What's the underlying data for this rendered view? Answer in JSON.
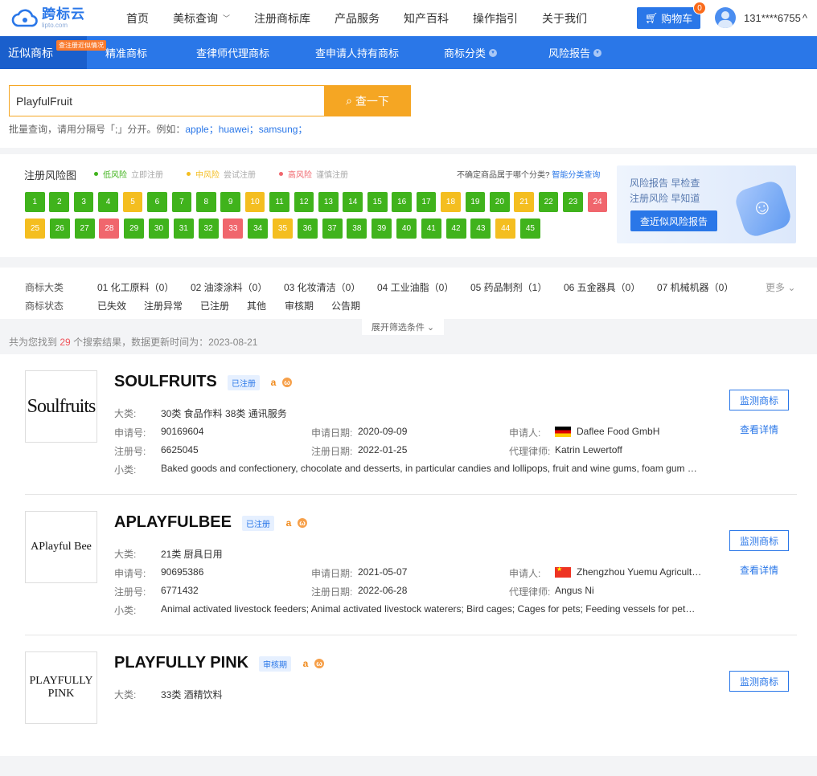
{
  "header": {
    "logo_text": "跨标云",
    "logo_sub": "lipto.com",
    "nav": [
      "首页",
      "美标查询",
      "注册商标库",
      "产品服务",
      "知产百科",
      "操作指引",
      "关于我们"
    ],
    "cart_label": "购物车",
    "cart_count": "0",
    "user_phone": "131****6755",
    "user_caret": "^"
  },
  "bluebar": {
    "tabs": [
      "近似商标",
      "精准商标",
      "查律师代理商标",
      "查申请人持有商标",
      "商标分类",
      "风险报告"
    ],
    "active_badge": "查注册近似情况",
    "dropdown_marker": "▾"
  },
  "search": {
    "value": "PlayfulFruit",
    "button": "查一下",
    "hint_prefix": "批量查询，请用分隔号「;」分开。例如：",
    "examples": "apple；huawei；samsung；"
  },
  "risk": {
    "title": "注册风险图",
    "legend": [
      {
        "label": "低风险",
        "sub": "立即注册",
        "color": "#40b31c"
      },
      {
        "label": "中风险",
        "sub": "尝试注册",
        "color": "#f4be20"
      },
      {
        "label": "高风险",
        "sub": "谨慎注册",
        "color": "#f0666d"
      }
    ],
    "question": "不确定商品属于哪个分类?",
    "question_link": "智能分类查询",
    "classes": [
      [
        "1",
        "g"
      ],
      [
        "2",
        "g"
      ],
      [
        "3",
        "g"
      ],
      [
        "4",
        "g"
      ],
      [
        "5",
        "y"
      ],
      [
        "6",
        "g"
      ],
      [
        "7",
        "g"
      ],
      [
        "8",
        "g"
      ],
      [
        "9",
        "g"
      ],
      [
        "10",
        "y"
      ],
      [
        "11",
        "g"
      ],
      [
        "12",
        "g"
      ],
      [
        "13",
        "g"
      ],
      [
        "14",
        "g"
      ],
      [
        "15",
        "g"
      ],
      [
        "16",
        "g"
      ],
      [
        "17",
        "g"
      ],
      [
        "18",
        "y"
      ],
      [
        "19",
        "g"
      ],
      [
        "20",
        "g"
      ],
      [
        "21",
        "y"
      ],
      [
        "22",
        "g"
      ],
      [
        "23",
        "g"
      ],
      [
        "24",
        "r"
      ],
      [
        "25",
        "y"
      ],
      [
        "26",
        "g"
      ],
      [
        "27",
        "g"
      ],
      [
        "28",
        "r"
      ],
      [
        "29",
        "g"
      ],
      [
        "30",
        "g"
      ],
      [
        "31",
        "g"
      ],
      [
        "32",
        "g"
      ],
      [
        "33",
        "r"
      ],
      [
        "34",
        "g"
      ],
      [
        "35",
        "y"
      ],
      [
        "36",
        "g"
      ],
      [
        "37",
        "g"
      ],
      [
        "38",
        "g"
      ],
      [
        "39",
        "g"
      ],
      [
        "40",
        "g"
      ],
      [
        "41",
        "g"
      ],
      [
        "42",
        "g"
      ],
      [
        "43",
        "g"
      ],
      [
        "44",
        "y"
      ],
      [
        "45",
        "g"
      ]
    ],
    "promo_line1": "风险报告 早检查",
    "promo_line2": "注册风险 早知道",
    "promo_button": "查近似风险报告"
  },
  "filter": {
    "class_label": "商标大类",
    "classes": [
      "01 化工原料（0）",
      "02 油漆涂料（0）",
      "03 化妆清洁（0）",
      "04 工业油脂（0）",
      "05 药品制剂（1）",
      "06 五金器具（0）",
      "07 机械机器（0）"
    ],
    "more": "更多 ⌄",
    "status_label": "商标状态",
    "statuses": [
      "已失效",
      "注册异常",
      "已注册",
      "其他",
      "审核期",
      "公告期"
    ],
    "expand": "展开筛选条件 ⌄"
  },
  "result_count": {
    "prefix": "共为您找到",
    "num": "29",
    "suffix": "个搜索结果，数据更新时间为：2023-08-21"
  },
  "labels": {
    "class": "大类:",
    "app_no": "申请号:",
    "app_date": "申请日期:",
    "applicant": "申请人:",
    "reg_no": "注册号:",
    "reg_date": "注册日期:",
    "agent": "代理律师:",
    "sub": "小类:",
    "monitor": "监测商标",
    "detail": "查看详情"
  },
  "results": [
    {
      "name": "SOULFRUITS",
      "status": "已注册",
      "thumb": "Soulfruits",
      "classes": "30类 食品作料   38类 通讯服务",
      "app_no": "90169604",
      "app_date": "2020-09-09",
      "applicant": "Daflee Food GmbH",
      "flag": "de",
      "reg_no": "6625045",
      "reg_date": "2022-01-25",
      "agent": "Katrin Lewertoff",
      "sub": "Baked goods and confectionery, chocolate and desserts, in particular candies and lollipops, fruit and wine gums, foam gum sweets"
    },
    {
      "name": "APLAYFULBEE",
      "status": "已注册",
      "thumb": "APlayful Bee",
      "classes": "21类 厨具日用",
      "app_no": "90695386",
      "app_date": "2021-05-07",
      "applicant": "Zhengzhou Yuemu Agricultural",
      "flag": "cn",
      "reg_no": "6771432",
      "reg_date": "2022-06-28",
      "agent": "Angus Ni",
      "sub": "Animal activated livestock feeders; Animal activated livestock waterers; Bird cages; Cages for pets; Feeding vessels for pets; Fl"
    },
    {
      "name": "PLAYFULLY PINK",
      "status": "审核期",
      "thumb": "PLAYFULLY PINK",
      "classes": "33类 酒精饮料"
    }
  ]
}
